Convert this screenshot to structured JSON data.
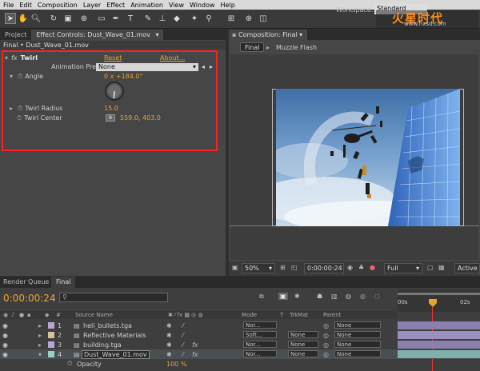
{
  "menu": [
    "File",
    "Edit",
    "Composition",
    "Layer",
    "Effect",
    "Animation",
    "View",
    "Window",
    "Help"
  ],
  "workspace": {
    "label": "Workspace:",
    "value": "Standard"
  },
  "watermark": {
    "brand": "火星时代",
    "url": "www.hxsd.com"
  },
  "left_tabs": {
    "project": "Project",
    "effect_controls": "Effect Controls: Dust_Wave_01.mov"
  },
  "ec_subtitle": "Final • Dust_Wave_01.mov",
  "effect": {
    "name": "Twirl",
    "reset": "Reset",
    "about": "About...",
    "presets_label": "Animation Presets:",
    "presets_value": "None",
    "angle_label": "Angle",
    "angle_value": "0 x +184.0°",
    "radius_label": "Twirl Radius",
    "radius_value": "15.0",
    "center_label": "Twirl Center",
    "center_value": "559.0, 403.0"
  },
  "comp": {
    "tab": "Composition: Final",
    "crumb_final": "Final",
    "crumb_layer": "Muzzle Flash"
  },
  "viewer_bar": {
    "zoom": "50%",
    "time": "0:00:00:24",
    "quality": "Full",
    "camera": "Active Ca"
  },
  "timeline": {
    "tabs": [
      "Render Queue",
      "Final"
    ],
    "timecode": "0:00:00:24",
    "search_placeholder": "",
    "col_source": "Source Name",
    "col_mode": "Mode",
    "col_t": "T",
    "col_trkmat": "TrkMat",
    "col_parent": "Parent",
    "ruler": [
      "00s",
      "02s"
    ],
    "layers": [
      {
        "num": "1",
        "name": "heli_bullets.tga",
        "mode": "Nor...",
        "trkmat": "",
        "parent": "None",
        "color": "#b8a6d8"
      },
      {
        "num": "2",
        "name": "Reflective Materials",
        "mode": "Soft...",
        "trkmat": "None",
        "parent": "None",
        "color": "#d8c0a0"
      },
      {
        "num": "3",
        "name": "building.tga",
        "mode": "Nor...",
        "trkmat": "None",
        "parent": "None",
        "color": "#b8a6d8"
      },
      {
        "num": "4",
        "name": "Dust_Wave_01.mov",
        "mode": "Nor...",
        "trkmat": "None",
        "parent": "None",
        "color": "#9ccfc8"
      }
    ],
    "opacity_label": "Opacity",
    "opacity_value": "100 %"
  },
  "colors": {
    "accent": "#e8a530",
    "highlight": "#ff1f1f"
  }
}
